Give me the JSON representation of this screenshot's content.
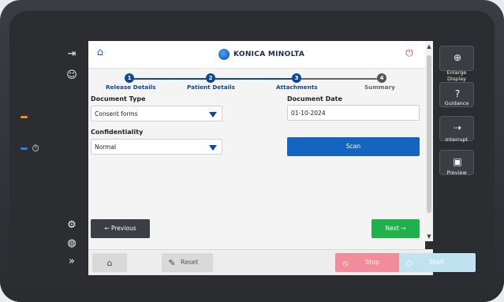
{
  "app": {
    "brand": "KONICA MINOLTA"
  },
  "stepper": {
    "steps": [
      {
        "num": "1",
        "label": "Release Details"
      },
      {
        "num": "2",
        "label": "Patient Details"
      },
      {
        "num": "3",
        "label": "Attachments"
      },
      {
        "num": "4",
        "label": "Summary"
      }
    ]
  },
  "form": {
    "document_type_label": "Document Type",
    "document_type_value": "Consent forms",
    "document_date_label": "Document Date",
    "document_date_value": "01-10-2024",
    "confidentiality_label": "Confidentiality",
    "confidentiality_value": "Normal"
  },
  "buttons": {
    "scan": "Scan",
    "previous": "←  Previous",
    "next": "Next  →",
    "reset": "Reset",
    "stop": "Stop",
    "start": "Start"
  },
  "right_panel": {
    "enlarge": "Enlarge Display",
    "guidance": "Guidance",
    "interrupt": "Interrupt",
    "preview": "Preview"
  },
  "colors": {
    "primary": "#0d47a1",
    "success": "#1fb24a",
    "stop": "#f28c9a",
    "start": "#bfe3f0"
  },
  "icons": {
    "home": "home-icon",
    "power": "power-icon",
    "logout": "logout-icon",
    "user": "user-icon",
    "settings": "gear-icon",
    "network": "globe-icon",
    "expand": "double-chevron-right-icon"
  }
}
